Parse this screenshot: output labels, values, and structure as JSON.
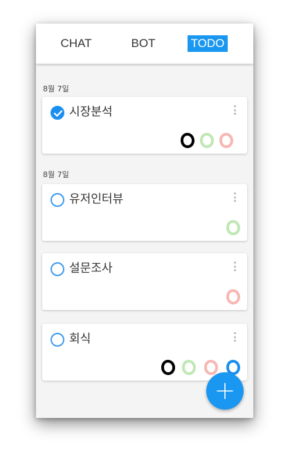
{
  "tabs": [
    {
      "label": "CHAT",
      "active": false
    },
    {
      "label": "BOT",
      "active": false
    },
    {
      "label": "TODO",
      "active": true
    }
  ],
  "groups": [
    {
      "date": "8월 7일",
      "items": [
        {
          "title": "시장분석",
          "done": true,
          "avatars": [
            "black",
            "green",
            "pink"
          ]
        }
      ]
    },
    {
      "date": "8월 7일",
      "items": [
        {
          "title": "유저인터뷰",
          "done": false,
          "avatars": [
            "green"
          ]
        },
        {
          "title": "설문조사",
          "done": false,
          "avatars": [
            "pink"
          ]
        },
        {
          "title": "회식",
          "done": false,
          "avatars": [
            "black",
            "green",
            "pink",
            "blue"
          ]
        }
      ]
    }
  ],
  "colors": {
    "accent": "#1a97f0",
    "black": "#000000",
    "green": "#bfe8b4",
    "pink": "#f7b7b2",
    "blue": "#1a8ff0"
  },
  "icons": {
    "check": "check-icon",
    "menu": "more-vertical-icon",
    "fab": "plus-icon"
  }
}
